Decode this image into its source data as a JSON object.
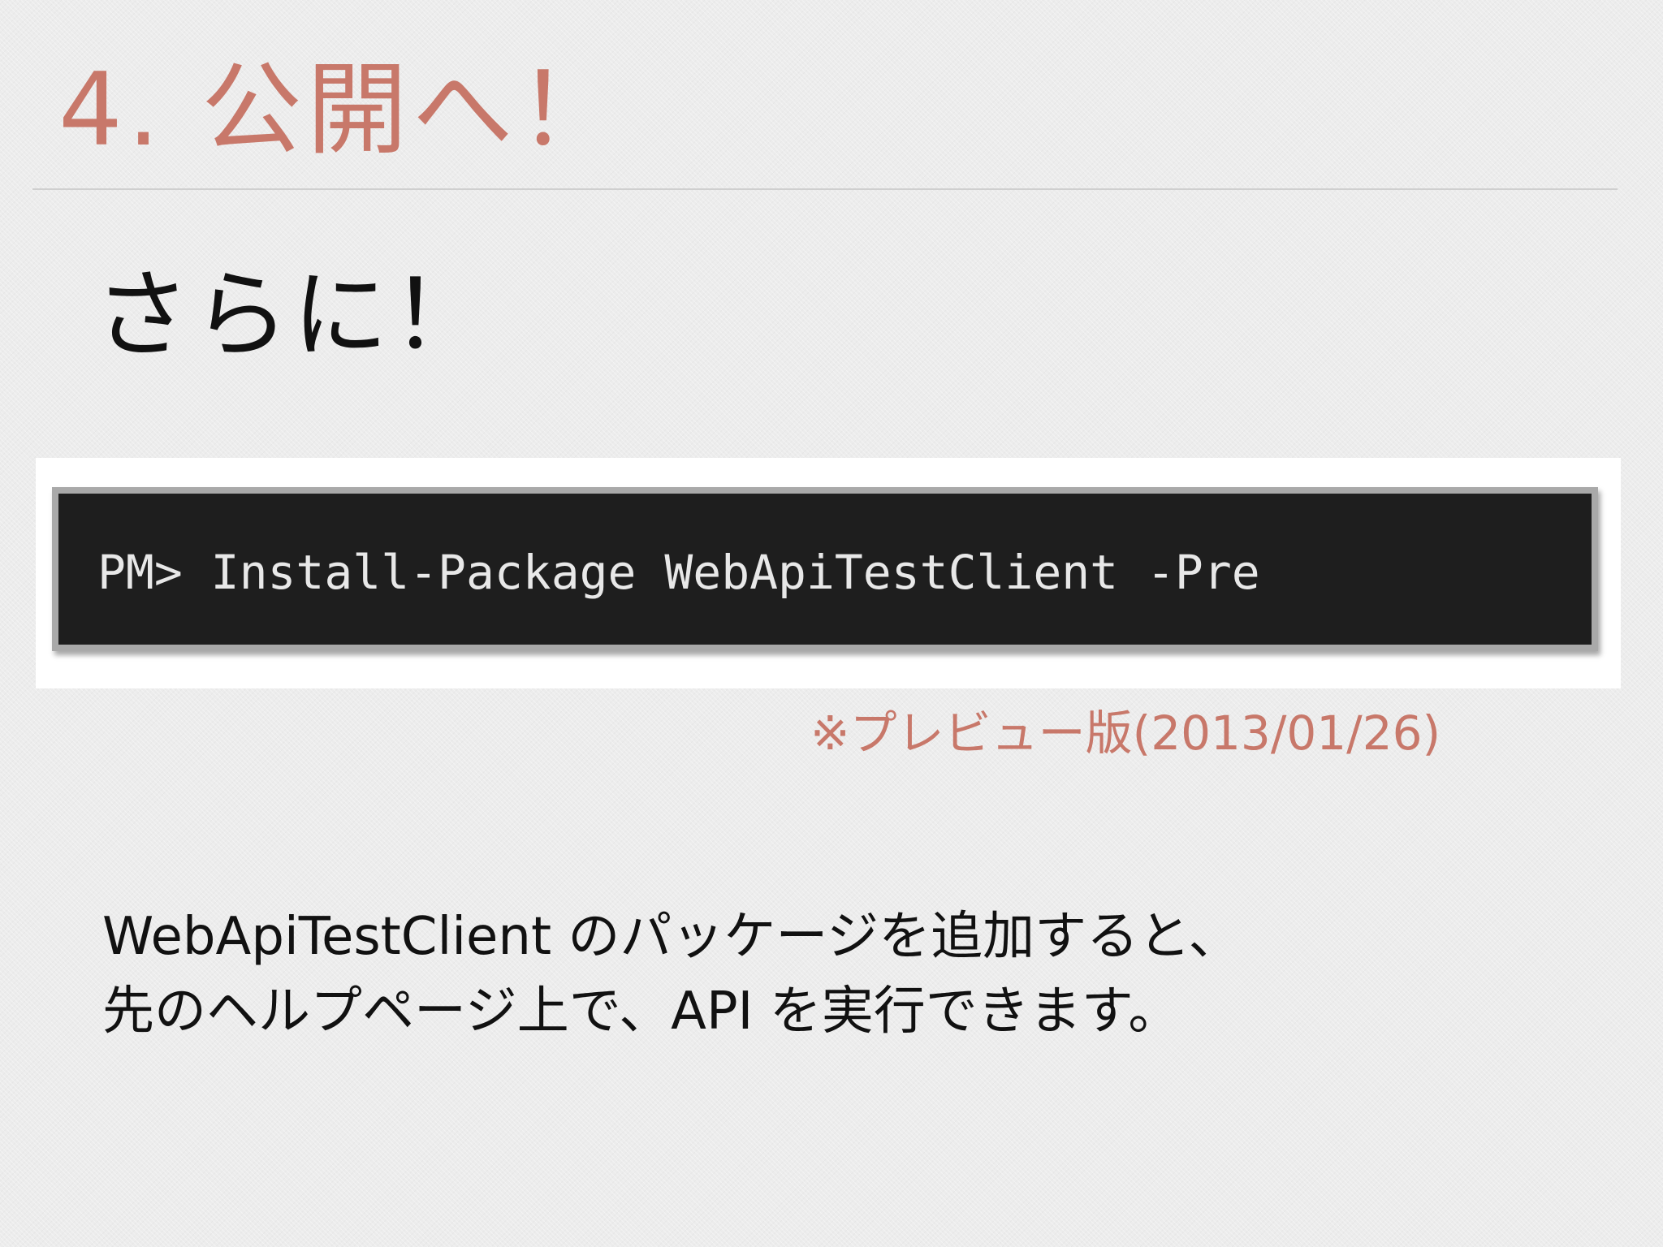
{
  "slide": {
    "title": "4. 公開へ！",
    "subheading": "さらに！",
    "console": {
      "command": "PM> Install-Package WebApiTestClient -Pre"
    },
    "note": "※プレビュー版(2013/01/26)",
    "body_lines": [
      "WebApiTestClient のパッケージを追加すると、",
      "先のヘルプページ上で、API を実行できます。"
    ]
  },
  "colors": {
    "accent": "#c8786a",
    "console_background": "#1e1e1e",
    "console_text": "#e8e8e8",
    "text": "#111111"
  }
}
